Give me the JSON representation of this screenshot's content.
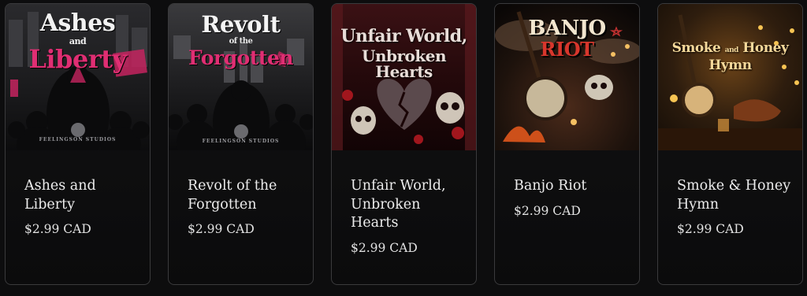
{
  "products": [
    {
      "art_title_lines": [
        "Ashes",
        "and",
        "Liberty"
      ],
      "art_sub": "FEELINGSON STUDIOS",
      "name": "Ashes and Liberty",
      "price": "$2.99 CAD",
      "accent": "#e02e73",
      "icon": "album-cover"
    },
    {
      "art_title_lines": [
        "Revolt",
        "of the",
        "Forgotten"
      ],
      "art_sub": "FEELINGSON STUDIOS",
      "name": "Revolt of the Forgotten",
      "price": "$2.99 CAD",
      "accent": "#e02e73",
      "icon": "album-cover"
    },
    {
      "art_title_lines": [
        "Unfair World,",
        "Unbroken Hearts"
      ],
      "name": "Unfair World, Unbroken Hearts",
      "price": "$2.99 CAD",
      "accent": "#b8323c",
      "icon": "album-cover"
    },
    {
      "art_title_lines": [
        "BANJO",
        "RIOT"
      ],
      "name": "Banjo Riot",
      "price": "$2.99 CAD",
      "accent": "#c8342a",
      "icon": "album-cover"
    },
    {
      "art_title_lines": [
        "Smoke",
        "and",
        "Honey",
        "Hymn"
      ],
      "name": "Smoke & Honey Hymn",
      "price": "$2.99 CAD",
      "accent": "#f2c24a",
      "icon": "album-cover"
    }
  ]
}
